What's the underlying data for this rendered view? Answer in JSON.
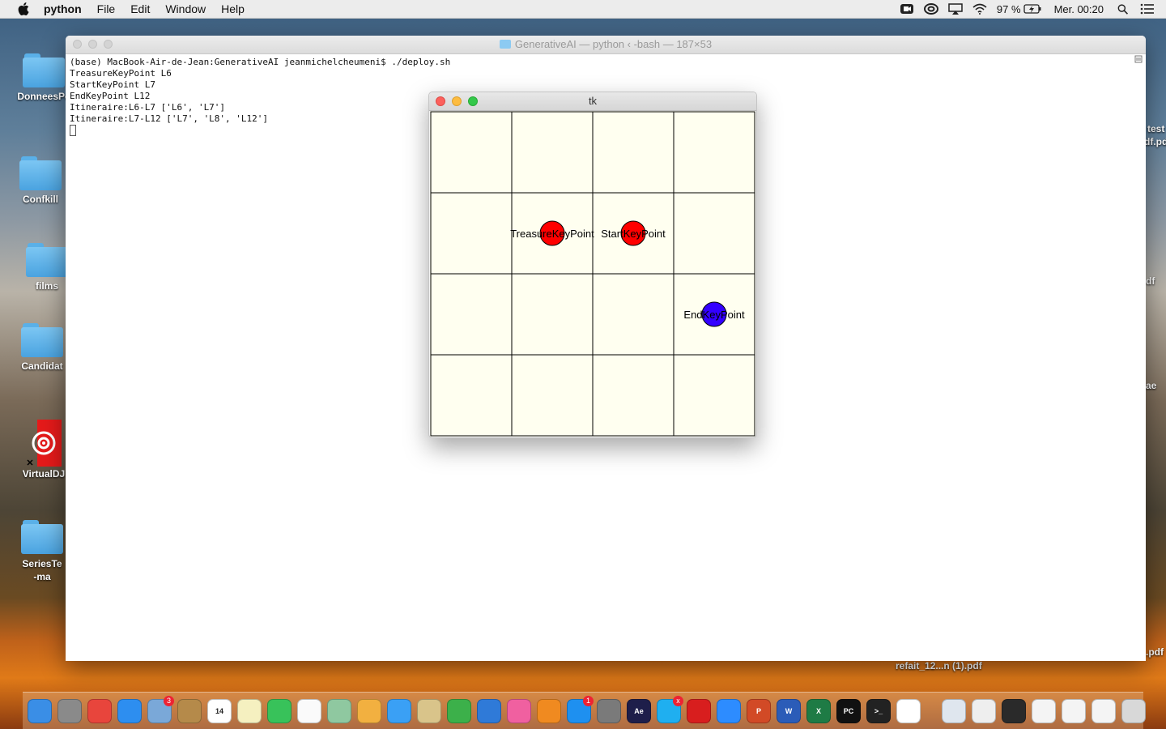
{
  "menubar": {
    "app_name": "python",
    "items": [
      "File",
      "Edit",
      "Window",
      "Help"
    ],
    "battery": "97 %",
    "clock": "Mer. 00:20"
  },
  "desktop": {
    "icons": [
      {
        "label": "DonneesPe",
        "kind": "folder"
      },
      {
        "label": "Confkill",
        "kind": "folder"
      },
      {
        "label": "films",
        "kind": "folder"
      },
      {
        "label": "Candidat",
        "kind": "folder"
      },
      {
        "label": "VirtualDJ",
        "kind": "app"
      },
      {
        "label": "SeriesTe",
        "label2": "-ma",
        "kind": "folder"
      }
    ],
    "right_labels": [
      "test",
      "df.pd",
      "df",
      "ae",
      ".pdf"
    ],
    "bottom_labels": [
      "refait_12...n (1).pdf"
    ]
  },
  "terminal": {
    "title": "GenerativeAI — python ‹ -bash — 187×53",
    "lines": [
      "(base) MacBook-Air-de-Jean:GenerativeAI jeanmichelcheumeni$ ./deploy.sh",
      "TreasureKeyPoint L6",
      "StartKeyPoint L7",
      "EndKeyPoint L12",
      "Itineraire:L6-L7 ['L6', 'L7']",
      "Itineraire:L7-L12 ['L7', 'L8', 'L12']"
    ]
  },
  "tk_window": {
    "title": "tk",
    "grid": {
      "rows": 4,
      "cols": 4,
      "background": "#fffff0",
      "line_color": "#000000"
    },
    "points": [
      {
        "label": "TreasureKeyPoint",
        "row": 1,
        "col": 1,
        "color": "#ff0000"
      },
      {
        "label": "StartKeyPoint",
        "row": 1,
        "col": 2,
        "color": "#ff0000"
      },
      {
        "label": "EndKeyPoint",
        "row": 2,
        "col": 3,
        "color": "#3300ff"
      }
    ]
  },
  "dock": {
    "apps": [
      {
        "name": "finder-icon",
        "color": "#3a8ee6"
      },
      {
        "name": "launchpad-icon",
        "color": "#8a8a8a"
      },
      {
        "name": "chrome-icon",
        "color": "#e8453c"
      },
      {
        "name": "safari-icon",
        "color": "#2d8ef0"
      },
      {
        "name": "preview-icon",
        "color": "#7aa8d8",
        "badge": "3"
      },
      {
        "name": "notes-brown-icon",
        "color": "#b58a4a"
      },
      {
        "name": "calendar-icon",
        "color": "#ffffff",
        "text": "14"
      },
      {
        "name": "stickies-icon",
        "color": "#f5f0c0"
      },
      {
        "name": "facetime-icon",
        "color": "#38c25a"
      },
      {
        "name": "reminders-icon",
        "color": "#fafafa"
      },
      {
        "name": "maps-icon",
        "color": "#8fc8a0"
      },
      {
        "name": "photos-icon",
        "color": "#f2b040"
      },
      {
        "name": "messages-icon",
        "color": "#3aa0f5"
      },
      {
        "name": "scripteditor-icon",
        "color": "#d9c48a"
      },
      {
        "name": "numbers-icon",
        "color": "#3cb04a"
      },
      {
        "name": "keynote-icon",
        "color": "#2f7ad8"
      },
      {
        "name": "itunes-icon",
        "color": "#f060a0"
      },
      {
        "name": "books-icon",
        "color": "#f08a20"
      },
      {
        "name": "appstore-icon",
        "color": "#1e90f0",
        "badge": "1"
      },
      {
        "name": "systemprefs-icon",
        "color": "#7a7a7a"
      },
      {
        "name": "aftereffects-icon",
        "color": "#1e1e4a",
        "text": "Ae"
      },
      {
        "name": "skype-icon",
        "color": "#1faff0",
        "badge": "x"
      },
      {
        "name": "acrobat-icon",
        "color": "#d81e1e"
      },
      {
        "name": "zoom-icon",
        "color": "#2d8cff"
      },
      {
        "name": "powerpoint-icon",
        "color": "#d24a26",
        "text": "P"
      },
      {
        "name": "word-icon",
        "color": "#2b5cb8",
        "text": "W"
      },
      {
        "name": "excel-icon",
        "color": "#1e7b45",
        "text": "X"
      },
      {
        "name": "pycharm-icon",
        "color": "#111111",
        "text": "PC"
      },
      {
        "name": "terminal-icon",
        "color": "#222222",
        "text": ">_"
      },
      {
        "name": "document-icon",
        "color": "#ffffff"
      },
      {
        "name": "window-thumb-1-icon",
        "color": "#dfe6ee"
      },
      {
        "name": "window-thumb-2-icon",
        "color": "#eeeeee"
      },
      {
        "name": "window-thumb-3-icon",
        "color": "#2a2a2a"
      },
      {
        "name": "window-thumb-4-icon",
        "color": "#f4f4f4"
      },
      {
        "name": "window-thumb-5-icon",
        "color": "#f4f4f4"
      },
      {
        "name": "window-thumb-6-icon",
        "color": "#f4f4f4"
      },
      {
        "name": "trash-icon",
        "color": "#d8d8d8"
      }
    ]
  }
}
